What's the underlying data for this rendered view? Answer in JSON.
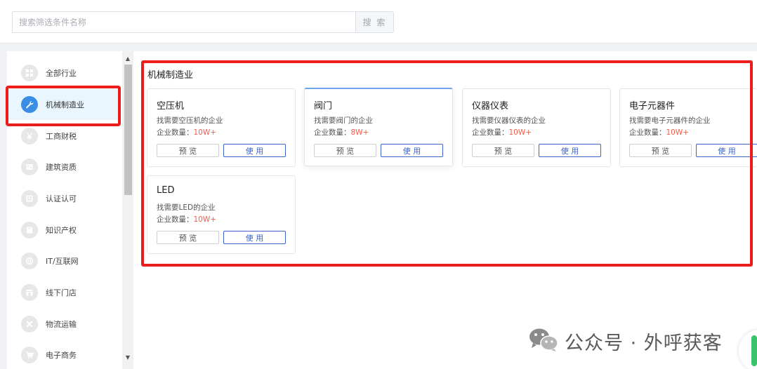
{
  "search": {
    "placeholder": "搜索筛选条件名称",
    "button_label": "搜 索"
  },
  "sidebar": {
    "items": [
      {
        "label": "全部行业",
        "icon": "grid-icon",
        "active": false
      },
      {
        "label": "机械制造业",
        "icon": "wrench-icon",
        "active": true
      },
      {
        "label": "工商财税",
        "icon": "yen-icon",
        "active": false
      },
      {
        "label": "建筑资质",
        "icon": "certificate-icon",
        "active": false
      },
      {
        "label": "认证认可",
        "icon": "badge-icon",
        "active": false
      },
      {
        "label": "知识产权",
        "icon": "book-icon",
        "active": false
      },
      {
        "label": "IT/互联网",
        "icon": "globe-icon",
        "active": false
      },
      {
        "label": "线下门店",
        "icon": "store-icon",
        "active": false
      },
      {
        "label": "物流运输",
        "icon": "truck-icon",
        "active": false
      },
      {
        "label": "电子商务",
        "icon": "cart-icon",
        "active": false
      }
    ]
  },
  "main": {
    "section_title": "机械制造业",
    "cards": [
      {
        "title": "空压机",
        "desc": "找需要空压机的企业",
        "count_label": "企业数量：",
        "count": "10W+",
        "preview": "预 览",
        "use": "使 用"
      },
      {
        "title": "阀门",
        "desc": "找需要阀门的企业",
        "count_label": "企业数量：",
        "count": "8W+",
        "preview": "预 览",
        "use": "使 用"
      },
      {
        "title": "仪器仪表",
        "desc": "找需要仪器仪表的企业",
        "count_label": "企业数量：",
        "count": "10W+",
        "preview": "预 览",
        "use": "使 用"
      },
      {
        "title": "电子元器件",
        "desc": "找需要电子元器件的企业",
        "count_label": "企业数量：",
        "count": "10W+",
        "preview": "预 览",
        "use": "使 用"
      },
      {
        "title": "LED",
        "desc": "找需要LED的企业",
        "count_label": "企业数量：",
        "count": "10W+",
        "preview": "预 览",
        "use": "使 用"
      }
    ]
  },
  "watermark": {
    "text": "公众号 · 外呼获客",
    "icon": "wechat-icon"
  },
  "colors": {
    "accent": "#3e64c8",
    "active_bg": "#e9f6fe",
    "count_red": "#f05a4a",
    "highlight_red": "#ea1c1c"
  }
}
